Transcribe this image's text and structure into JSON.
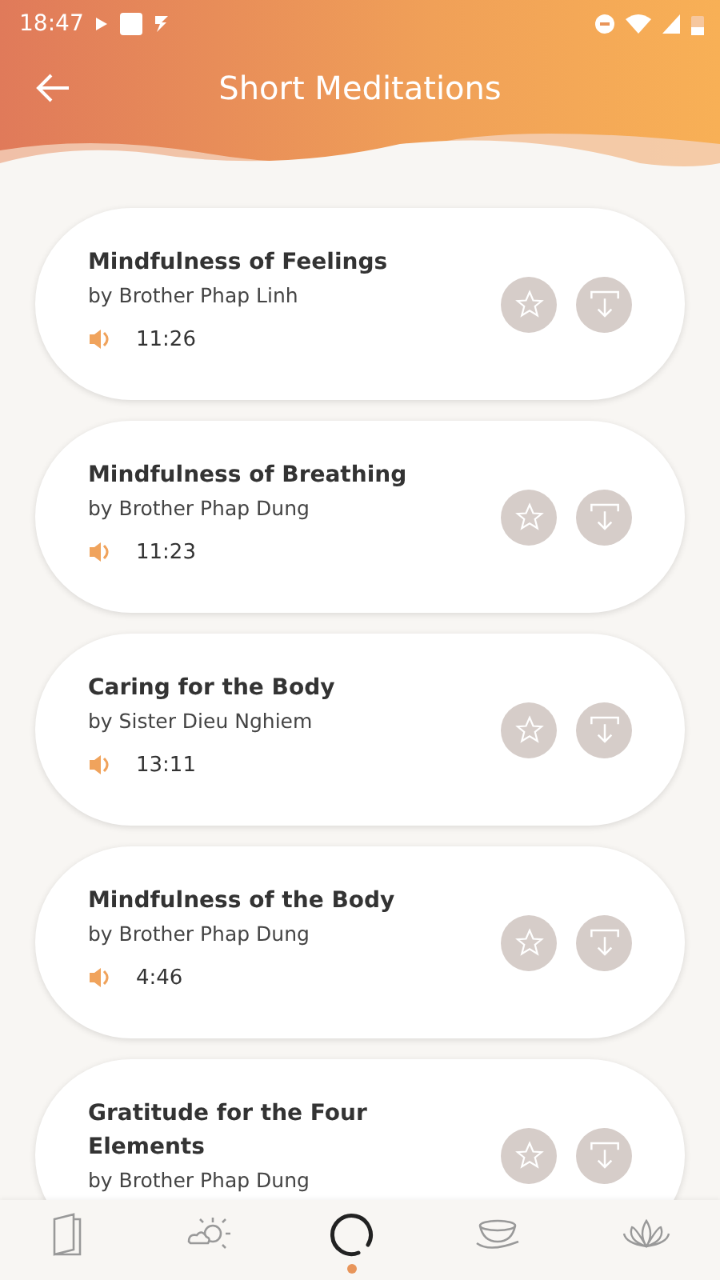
{
  "status_bar": {
    "time": "18:47"
  },
  "header": {
    "title": "Short Meditations"
  },
  "meditations": [
    {
      "title": "Mindfulness of Feelings",
      "author": "by Brother Phap Linh",
      "duration": "11:26"
    },
    {
      "title": "Mindfulness of Breathing",
      "author": "by Brother Phap Dung",
      "duration": "11:23"
    },
    {
      "title": "Caring for the Body",
      "author": "by Sister Dieu Nghiem",
      "duration": "13:11"
    },
    {
      "title": "Mindfulness of the Body",
      "author": "by Brother Phap Dung",
      "duration": "4:46"
    },
    {
      "title": "Gratitude for the Four Elements",
      "author": "by Brother Phap Dung"
    }
  ],
  "bottom_nav": [
    {
      "kind": "book",
      "selected": false
    },
    {
      "kind": "weather",
      "selected": false
    },
    {
      "kind": "circle",
      "selected": true
    },
    {
      "kind": "bowl",
      "selected": false
    },
    {
      "kind": "lotus",
      "selected": false
    }
  ]
}
